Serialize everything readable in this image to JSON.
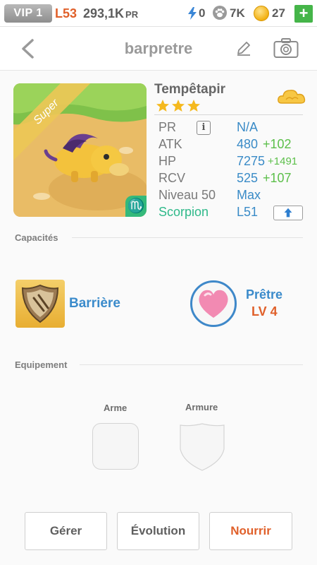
{
  "status_bar": {
    "vip_label": "VIP 1",
    "level": "L53",
    "power": "293,1K",
    "power_unit": "PR",
    "energy": "0",
    "paws": "7K",
    "coins": "27",
    "add_label": "+"
  },
  "header": {
    "title": "barpretre",
    "back_icon": "chevron-left-icon",
    "edit_icon": "pencil-icon",
    "camera_icon": "camera-icon"
  },
  "pet": {
    "rarity_badge": "Super",
    "sign_symbol": "♏",
    "name": "Tempêtapir",
    "stars": 3,
    "element_icon": "cloud-icon",
    "stats": {
      "pr": {
        "label": "PR",
        "value": "N/A"
      },
      "atk": {
        "label": "ATK",
        "value": "480",
        "bonus": "+102"
      },
      "hp": {
        "label": "HP",
        "value": "7275",
        "bonus": "+1491"
      },
      "rcv": {
        "label": "RCV",
        "value": "525",
        "bonus": "+107"
      },
      "level": {
        "label": "Niveau 50",
        "value": "Max"
      },
      "zodiac": {
        "label": "Scorpion",
        "value": "L51"
      }
    }
  },
  "abilities": {
    "heading": "Capacités",
    "skill_name": "Barrière",
    "class_name": "Prêtre",
    "class_level": "LV 4"
  },
  "equipment": {
    "heading": "Equipement",
    "weapon_label": "Arme",
    "armor_label": "Armure"
  },
  "actions": {
    "manage": "Gérer",
    "evolution": "Évolution",
    "feed": "Nourrir"
  },
  "colors": {
    "accent_blue": "#3b8bcb",
    "accent_orange": "#e0602a",
    "bonus_green": "#5cbf4a",
    "zodiac_green": "#2fb98a",
    "add_green": "#45b549"
  }
}
